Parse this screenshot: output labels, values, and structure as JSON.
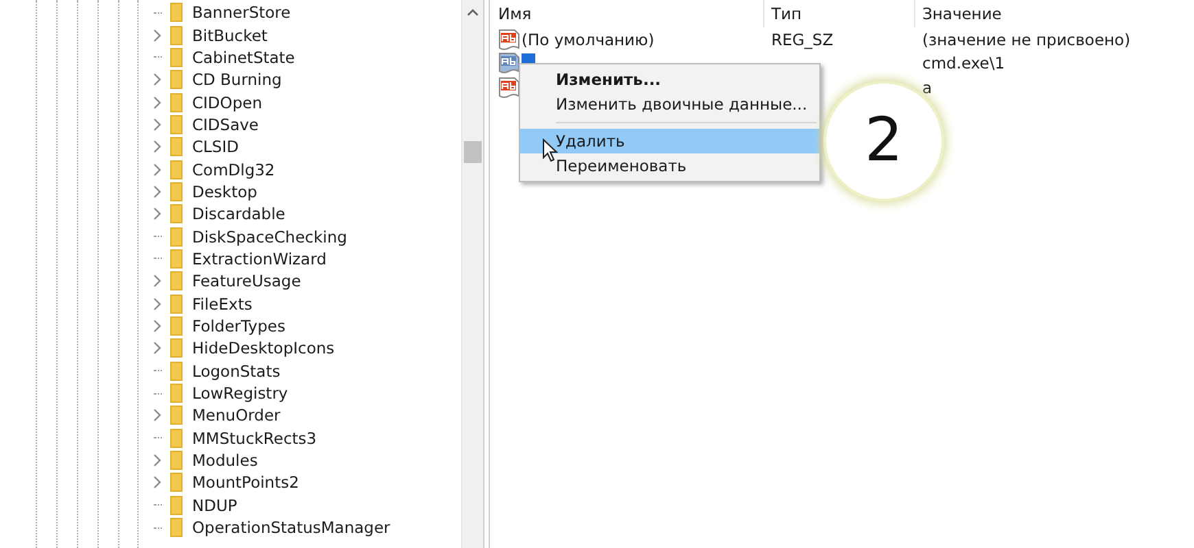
{
  "tree": {
    "items": [
      {
        "label": "BannerStore",
        "expandable": false
      },
      {
        "label": "BitBucket",
        "expandable": true
      },
      {
        "label": "CabinetState",
        "expandable": false
      },
      {
        "label": "CD Burning",
        "expandable": true
      },
      {
        "label": "CIDOpen",
        "expandable": true
      },
      {
        "label": "CIDSave",
        "expandable": true
      },
      {
        "label": "CLSID",
        "expandable": true
      },
      {
        "label": "ComDlg32",
        "expandable": true
      },
      {
        "label": "Desktop",
        "expandable": true
      },
      {
        "label": "Discardable",
        "expandable": true
      },
      {
        "label": "DiskSpaceChecking",
        "expandable": false
      },
      {
        "label": "ExtractionWizard",
        "expandable": false
      },
      {
        "label": "FeatureUsage",
        "expandable": true
      },
      {
        "label": "FileExts",
        "expandable": true
      },
      {
        "label": "FolderTypes",
        "expandable": true
      },
      {
        "label": "HideDesktopIcons",
        "expandable": true
      },
      {
        "label": "LogonStats",
        "expandable": false
      },
      {
        "label": "LowRegistry",
        "expandable": false
      },
      {
        "label": "MenuOrder",
        "expandable": true
      },
      {
        "label": "MMStuckRects3",
        "expandable": false
      },
      {
        "label": "Modules",
        "expandable": true
      },
      {
        "label": "MountPoints2",
        "expandable": true
      },
      {
        "label": "NDUP",
        "expandable": false
      },
      {
        "label": "OperationStatusManager",
        "expandable": false
      }
    ]
  },
  "values": {
    "columns": [
      "Имя",
      "Тип",
      "Значение"
    ],
    "rows": [
      {
        "name": "(По умолчанию)",
        "type": "REG_SZ",
        "value": "(значение не присвоено)",
        "selected": false
      },
      {
        "value": "cmd.exe\\1",
        "selected": true
      },
      {
        "value": "a",
        "selected": false
      }
    ]
  },
  "context_menu": {
    "items": [
      {
        "label": "Изменить...",
        "bold": true,
        "selected": false
      },
      {
        "label": "Изменить двоичные данные...",
        "bold": false,
        "selected": false
      },
      {
        "kind": "separator"
      },
      {
        "label": "Удалить",
        "bold": false,
        "selected": true
      },
      {
        "label": "Переименовать",
        "bold": false,
        "selected": false
      }
    ]
  },
  "step_badge": "2"
}
